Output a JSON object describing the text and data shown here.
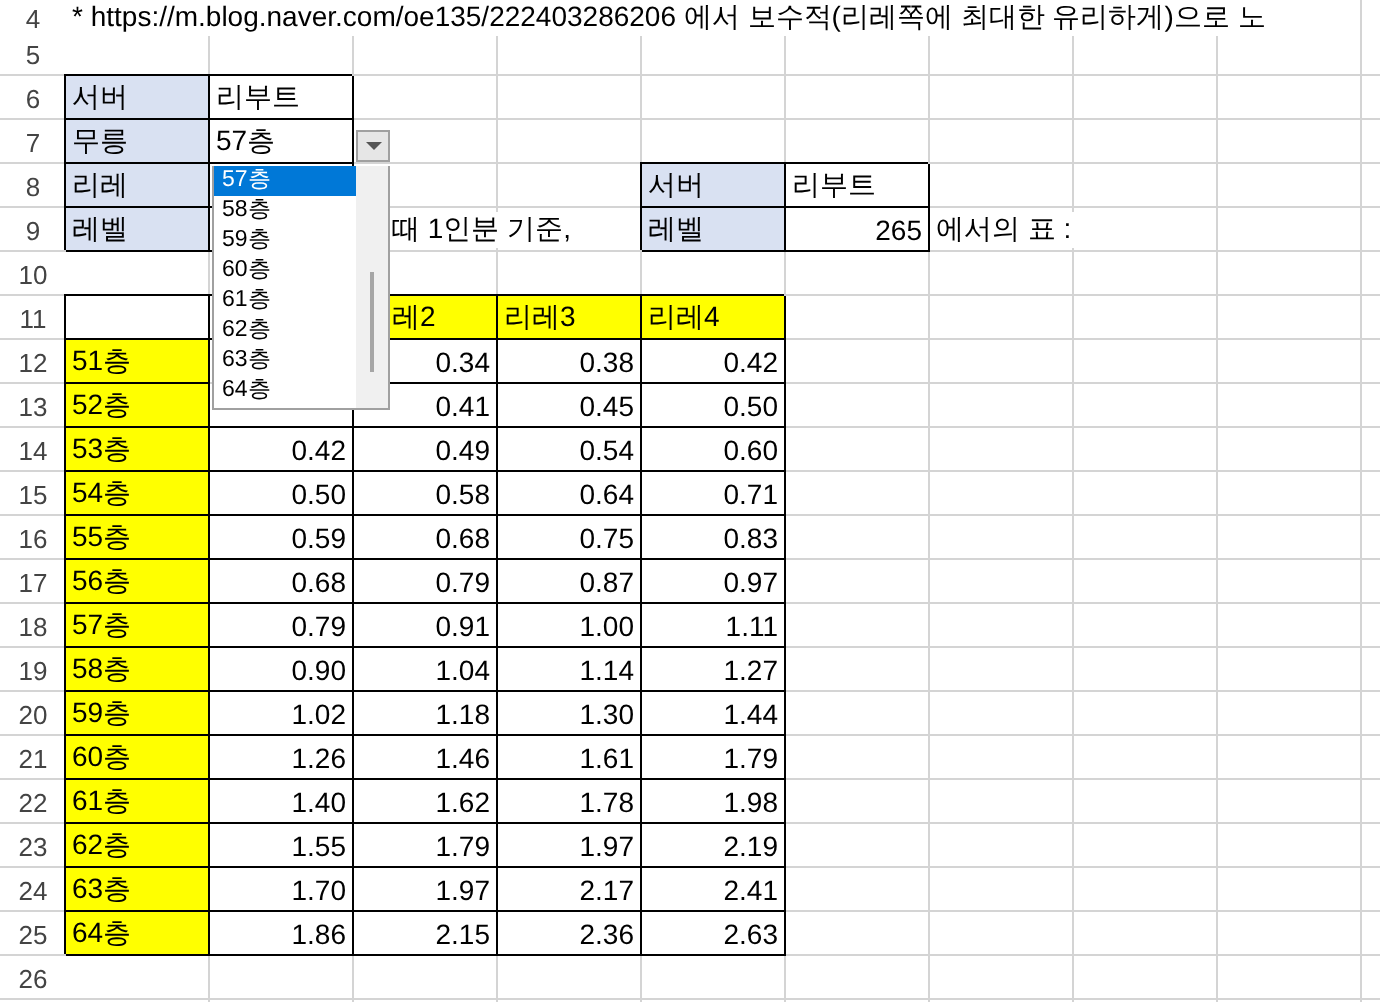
{
  "rows": [
    {
      "number": "4",
      "cells": [
        {
          "kind": "plain",
          "text": "* https://m.blog.naver.com/oe135/222403286206 에서 보수적(리레쪽에 최대한 유리하게)으로 노"
        }
      ]
    },
    {
      "number": "5",
      "cells": []
    },
    {
      "number": "6",
      "cells": [
        {
          "kind": "label",
          "text": "서버"
        },
        {
          "kind": "input",
          "text": "리부트"
        }
      ]
    },
    {
      "number": "7",
      "cells": [
        {
          "kind": "label",
          "text": "무릉"
        },
        {
          "kind": "input",
          "text": "57층"
        }
      ]
    },
    {
      "number": "8",
      "cells": [
        {
          "kind": "label",
          "text": "리레"
        },
        {
          "kind": "input"
        },
        {
          "kind": "empty"
        },
        {
          "kind": "empty"
        },
        {
          "kind": "label",
          "text": "서버"
        },
        {
          "kind": "input",
          "text": "리부트"
        }
      ]
    },
    {
      "number": "9",
      "cells": [
        {
          "kind": "label",
          "text": "레벨"
        },
        {
          "kind": "input"
        },
        {
          "kind": "plain_partial",
          "text": "때 1인분 기준,"
        },
        {
          "kind": "empty"
        },
        {
          "kind": "label",
          "text": "레벨"
        },
        {
          "kind": "number",
          "text": "265"
        },
        {
          "kind": "plain",
          "text": "에서의 표 :"
        }
      ]
    },
    {
      "number": "10",
      "cells": []
    },
    {
      "number": "11",
      "cells": [
        {
          "kind": "blank"
        },
        {
          "kind": "blank"
        },
        {
          "kind": "colhead_partial",
          "text": "레2"
        },
        {
          "kind": "colhead",
          "text": "리레3"
        },
        {
          "kind": "colhead",
          "text": "리레4"
        }
      ]
    },
    {
      "number": "12",
      "cells": [
        {
          "kind": "floor",
          "text": "51층"
        },
        {
          "kind": "empty"
        },
        {
          "kind": "number",
          "text": "0.34"
        },
        {
          "kind": "number",
          "text": "0.38"
        },
        {
          "kind": "number",
          "text": "0.42"
        }
      ]
    },
    {
      "number": "13",
      "cells": [
        {
          "kind": "floor",
          "text": "52층"
        },
        {
          "kind": "empty"
        },
        {
          "kind": "number",
          "text": "0.41"
        },
        {
          "kind": "number",
          "text": "0.45"
        },
        {
          "kind": "number",
          "text": "0.50"
        }
      ]
    },
    {
      "number": "14",
      "cells": [
        {
          "kind": "floor",
          "text": "53층"
        },
        {
          "kind": "number",
          "text": "0.42"
        },
        {
          "kind": "number",
          "text": "0.49"
        },
        {
          "kind": "number",
          "text": "0.54"
        },
        {
          "kind": "number",
          "text": "0.60"
        }
      ]
    },
    {
      "number": "15",
      "cells": [
        {
          "kind": "floor",
          "text": "54층"
        },
        {
          "kind": "number",
          "text": "0.50"
        },
        {
          "kind": "number",
          "text": "0.58"
        },
        {
          "kind": "number",
          "text": "0.64"
        },
        {
          "kind": "number",
          "text": "0.71"
        }
      ]
    },
    {
      "number": "16",
      "cells": [
        {
          "kind": "floor",
          "text": "55층"
        },
        {
          "kind": "number",
          "text": "0.59"
        },
        {
          "kind": "number",
          "text": "0.68"
        },
        {
          "kind": "number",
          "text": "0.75"
        },
        {
          "kind": "number",
          "text": "0.83"
        }
      ]
    },
    {
      "number": "17",
      "cells": [
        {
          "kind": "floor",
          "text": "56층"
        },
        {
          "kind": "number",
          "text": "0.68"
        },
        {
          "kind": "number",
          "text": "0.79"
        },
        {
          "kind": "number",
          "text": "0.87"
        },
        {
          "kind": "number",
          "text": "0.97"
        }
      ]
    },
    {
      "number": "18",
      "cells": [
        {
          "kind": "floor",
          "text": "57층"
        },
        {
          "kind": "number",
          "text": "0.79"
        },
        {
          "kind": "number",
          "text": "0.91"
        },
        {
          "kind": "number",
          "text": "1.00"
        },
        {
          "kind": "number",
          "text": "1.11"
        }
      ]
    },
    {
      "number": "19",
      "cells": [
        {
          "kind": "floor",
          "text": "58층"
        },
        {
          "kind": "number",
          "text": "0.90"
        },
        {
          "kind": "number",
          "text": "1.04"
        },
        {
          "kind": "number",
          "text": "1.14"
        },
        {
          "kind": "number",
          "text": "1.27"
        }
      ]
    },
    {
      "number": "20",
      "cells": [
        {
          "kind": "floor",
          "text": "59층"
        },
        {
          "kind": "number",
          "text": "1.02"
        },
        {
          "kind": "number",
          "text": "1.18"
        },
        {
          "kind": "number",
          "text": "1.30"
        },
        {
          "kind": "number",
          "text": "1.44"
        }
      ]
    },
    {
      "number": "21",
      "cells": [
        {
          "kind": "floor",
          "text": "60층"
        },
        {
          "kind": "number",
          "text": "1.26"
        },
        {
          "kind": "number",
          "text": "1.46"
        },
        {
          "kind": "number",
          "text": "1.61"
        },
        {
          "kind": "number",
          "text": "1.79"
        }
      ]
    },
    {
      "number": "22",
      "cells": [
        {
          "kind": "floor",
          "text": "61층"
        },
        {
          "kind": "number",
          "text": "1.40"
        },
        {
          "kind": "number",
          "text": "1.62"
        },
        {
          "kind": "number",
          "text": "1.78"
        },
        {
          "kind": "number",
          "text": "1.98"
        }
      ]
    },
    {
      "number": "23",
      "cells": [
        {
          "kind": "floor",
          "text": "62층"
        },
        {
          "kind": "number",
          "text": "1.55"
        },
        {
          "kind": "number",
          "text": "1.79"
        },
        {
          "kind": "number",
          "text": "1.97"
        },
        {
          "kind": "number",
          "text": "2.19"
        }
      ]
    },
    {
      "number": "24",
      "cells": [
        {
          "kind": "floor",
          "text": "63층"
        },
        {
          "kind": "number",
          "text": "1.70"
        },
        {
          "kind": "number",
          "text": "1.97"
        },
        {
          "kind": "number",
          "text": "2.17"
        },
        {
          "kind": "number",
          "text": "2.41"
        }
      ]
    },
    {
      "number": "25",
      "cells": [
        {
          "kind": "floor",
          "text": "64층"
        },
        {
          "kind": "number",
          "text": "1.86"
        },
        {
          "kind": "number",
          "text": "2.15"
        },
        {
          "kind": "number",
          "text": "2.36"
        },
        {
          "kind": "number",
          "text": "2.63"
        }
      ]
    },
    {
      "number": "26",
      "cells": []
    }
  ],
  "dropdown": {
    "items": [
      {
        "text": "57층",
        "selected": true
      },
      {
        "text": "58층",
        "selected": false
      },
      {
        "text": "59층",
        "selected": false
      },
      {
        "text": "60층",
        "selected": false
      },
      {
        "text": "61층",
        "selected": false
      },
      {
        "text": "62층",
        "selected": false
      },
      {
        "text": "63층",
        "selected": false
      },
      {
        "text": "64층",
        "selected": false
      }
    ]
  }
}
